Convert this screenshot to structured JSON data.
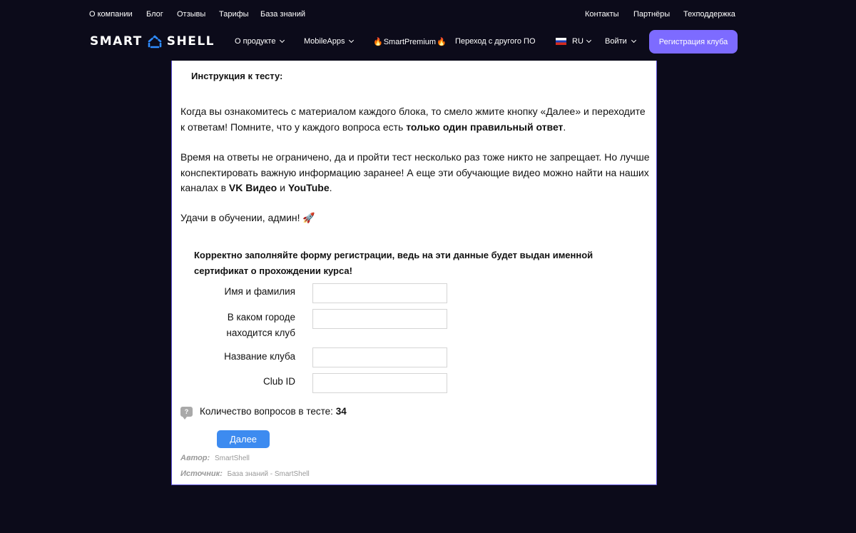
{
  "top_links": {
    "about": "О компании",
    "blog": "Блог",
    "reviews": "Отзывы",
    "pricing": "Тарифы",
    "knowledge": "База знаний",
    "contacts": "Контакты",
    "partners": "Партнёры",
    "support": "Техподдержка"
  },
  "logo": {
    "left": "SMART",
    "right": "SHELL"
  },
  "nav": {
    "product": "О продукте",
    "mobile": "MobileApps",
    "premium": "SmartPremium",
    "migrate": "Переход с другого ПО",
    "lang": "RU",
    "login": "Войти",
    "register": "Регистрация клуба"
  },
  "colors": {
    "background": "#0c0b1a",
    "accent": "#7d6bff",
    "button_blue": "#3d8bf0"
  },
  "content": {
    "instruction_title": "Инструкция к тесту:",
    "p1_a": "Когда вы ознакомитесь с материалом каждого блока, то смело жмите кнопку «Далее» и переходите к ответам! Помните, что у каждого вопроса есть ",
    "p1_b": "только один правильный ответ",
    "p1_c": ".",
    "p2_a": "Время на ответы не ограничено, да и пройти тест несколько раз тоже никто не запрещает. Но лучше конспектировать важную информацию заранее! А еще эти обучающие видео можно найти на наших каналах в ",
    "p2_vk": "VK Видео",
    "p2_and": " и ",
    "p2_yt": "YouTube",
    "p2_end": ".",
    "p3": "Удачи в обучении, админ! 🚀"
  },
  "form": {
    "title": "Корректно заполняйте форму регистрации, ведь на эти данные будет выдан именной сертификат о прохождении курса!",
    "name_label": "Имя и фамилия",
    "city_label_1": "В каком городе",
    "city_label_2": "находится клуб",
    "club_label": "Название клуба",
    "clubid_label": "Club ID"
  },
  "quiz": {
    "count_label": "Количество вопросов в тесте: ",
    "count": "34",
    "next": "Далее",
    "author_label": "Автор:",
    "author": "SmartShell",
    "source_label": "Источник:",
    "source": "База знаний - SmartShell"
  }
}
